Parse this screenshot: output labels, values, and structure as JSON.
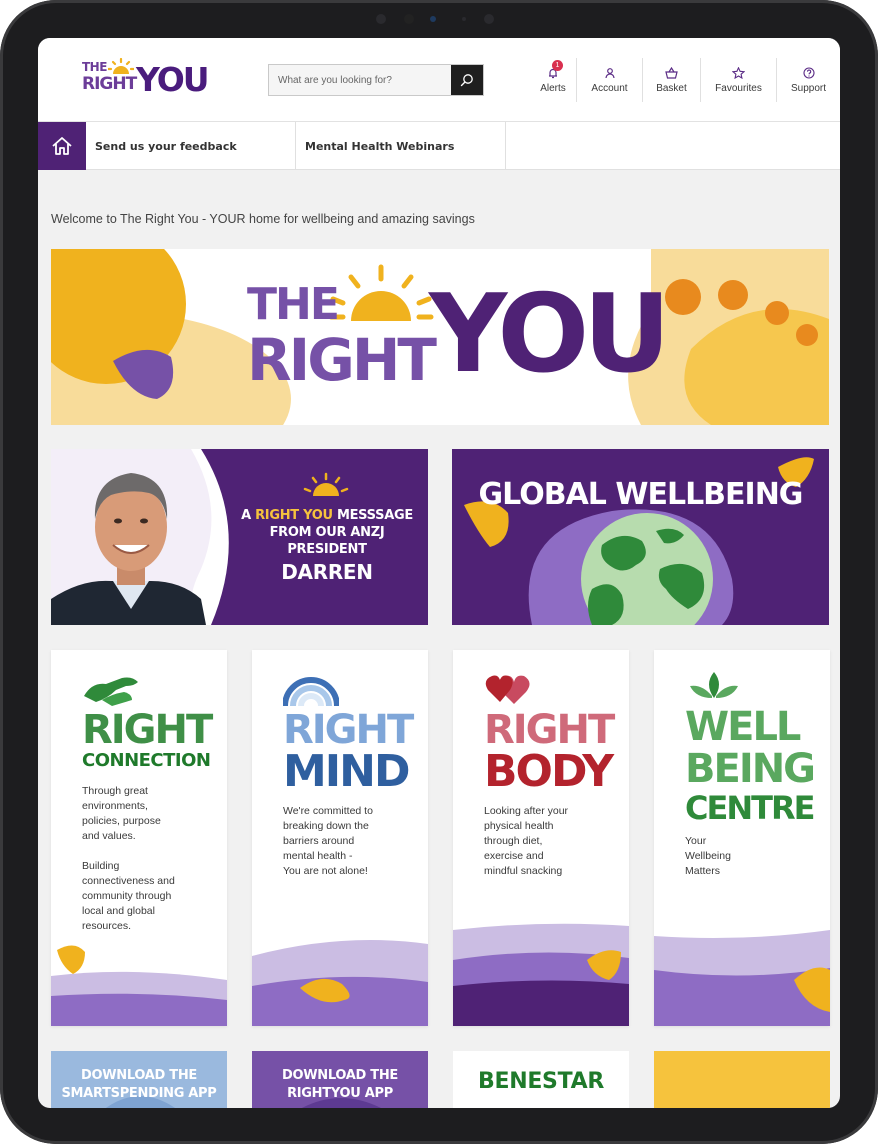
{
  "header": {
    "logo": {
      "the": "THE",
      "right": "RIGHT",
      "you": "YOU"
    },
    "search": {
      "placeholder": "What are you looking for?"
    },
    "nav": [
      {
        "label": "Alerts",
        "icon": "bell-icon",
        "badge": "1"
      },
      {
        "label": "Account",
        "icon": "user-icon"
      },
      {
        "label": "Basket",
        "icon": "basket-icon"
      },
      {
        "label": "Favourites",
        "icon": "star-icon"
      },
      {
        "label": "Support",
        "icon": "help-icon"
      }
    ]
  },
  "subnav": {
    "home_icon": "home-icon",
    "links": [
      "Send us your feedback",
      "Mental Health Webinars"
    ]
  },
  "welcome": "Welcome to The Right You - YOUR home for wellbeing and amazing savings",
  "hero": {
    "the": "THE",
    "right": "RIGHT",
    "you": "YOU"
  },
  "banners": {
    "president": {
      "line1_a": "A ",
      "line1_hl": "RIGHT YOU",
      "line1_b": " MESSSAGE",
      "line2": "FROM OUR ANZJ",
      "line3": "PRESIDENT",
      "name": "DARREN"
    },
    "global": {
      "title": "GLOBAL WELLBEING"
    }
  },
  "cards": [
    {
      "title1": "RIGHT",
      "title2": "CONNECTION",
      "desc": "Through great\nenvironments,\npolicies, purpose\nand values.\n\nBuilding\nconnectiveness and\ncommunity through\nlocal and global\nresources."
    },
    {
      "title1": "RIGHT",
      "title2": "MIND",
      "desc": "We're committed to\nbreaking down the\nbarriers around\nmental health -\nYou are not alone!"
    },
    {
      "title1": "RIGHT",
      "title2": "BODY",
      "desc": "Looking after your\nphysical health\nthrough diet,\nexercise and\nmindful snacking"
    },
    {
      "title1": "WELL",
      "title2": "BEING",
      "title3": "CENTRE",
      "desc": "Your\nWellbeing\nMatters"
    }
  ],
  "bottom_cards": [
    {
      "line1": "DOWNLOAD THE",
      "line2": "SMARTSPENDING APP"
    },
    {
      "line1": "DOWNLOAD THE",
      "line2": "RIGHTYOU APP"
    },
    {
      "line1": "BENESTAR"
    },
    {
      "line1": ""
    }
  ],
  "colors": {
    "purple_dark": "#4f2275",
    "purple_mid": "#7651a7",
    "lavender": "#cbbde3",
    "yellow": "#f0b21e",
    "orange": "#e88a1e",
    "green": "#2f8a3a",
    "blue": "#3d6fb5",
    "red": "#b3232d"
  }
}
